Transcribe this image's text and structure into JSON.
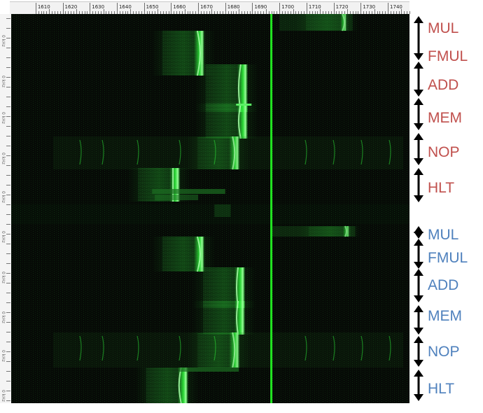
{
  "ruler": {
    "ticks": [
      "1610",
      "1620",
      "1630",
      "1640",
      "1650",
      "1660",
      "1670",
      "1680",
      "1690",
      "1700",
      "1710",
      "1720",
      "1730",
      "1740"
    ]
  },
  "side_scale": {
    "labels": [
      "0 kHz",
      "0 kHz",
      "0 kHz",
      "0 kHz",
      "0 kHz",
      "0 kHz",
      "0 kHz",
      "0 kHz",
      "0 kHz",
      "0 kHz"
    ]
  },
  "colors": {
    "signal": "#2eea3a",
    "background": "#050905",
    "marker_line": "#21e421",
    "group_1_label": "#c0504d",
    "group_2_label": "#4f81bd"
  },
  "marker_line_value": 1697,
  "annotations": [
    {
      "label": "MUL",
      "color": "#c0504d"
    },
    {
      "label": "FMUL",
      "color": "#c0504d"
    },
    {
      "label": "ADD",
      "color": "#c0504d"
    },
    {
      "label": "MEM",
      "color": "#c0504d"
    },
    {
      "label": "NOP",
      "color": "#c0504d"
    },
    {
      "label": "HLT",
      "color": "#c0504d"
    },
    {
      "label": "MUL",
      "color": "#4f81bd"
    },
    {
      "label": "FMUL",
      "color": "#4f81bd"
    },
    {
      "label": "ADD",
      "color": "#4f81bd"
    },
    {
      "label": "MEM",
      "color": "#4f81bd"
    },
    {
      "label": "NOP",
      "color": "#4f81bd"
    },
    {
      "label": "HLT",
      "color": "#4f81bd"
    }
  ]
}
